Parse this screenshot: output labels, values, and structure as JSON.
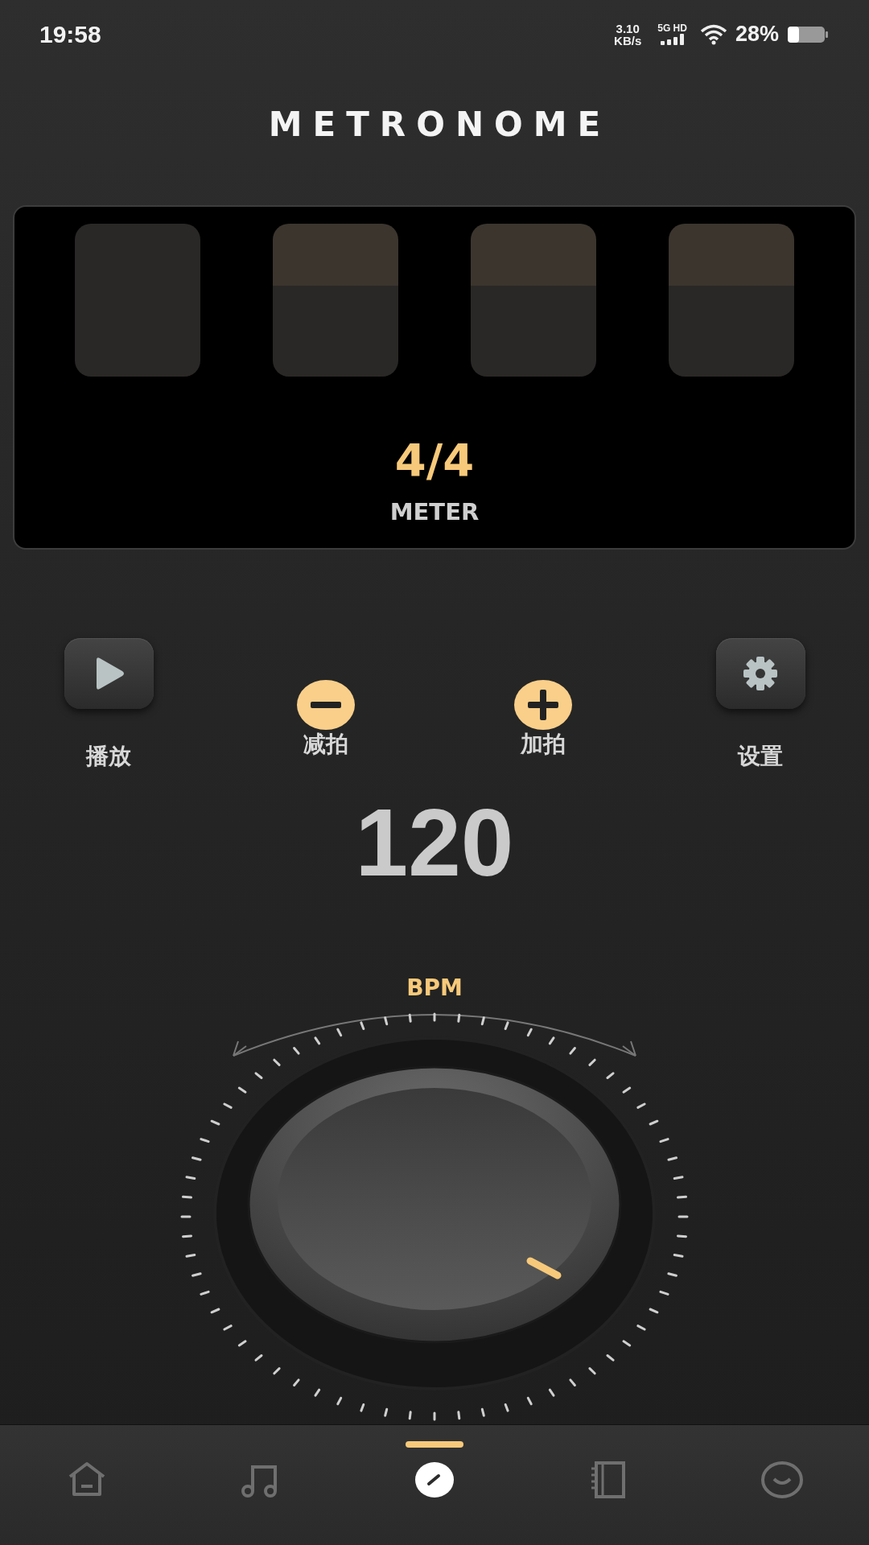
{
  "status_bar": {
    "time": "19:58",
    "net_speed": "3.10",
    "net_unit": "KB/s",
    "network": "5G HD",
    "battery": "28%"
  },
  "title": "METRONOME",
  "meter": {
    "beats": [
      {
        "kind": "plain"
      },
      {
        "kind": "banded"
      },
      {
        "kind": "banded"
      },
      {
        "kind": "banded"
      }
    ],
    "value": "4/4",
    "label": "METER"
  },
  "controls": [
    {
      "kind": "play",
      "label": "播放"
    },
    {
      "kind": "minus",
      "label": "减拍"
    },
    {
      "kind": "plus",
      "label": "加拍"
    },
    {
      "kind": "settings",
      "label": "设置"
    }
  ],
  "tempo": {
    "value": "120",
    "unit": "BPM"
  },
  "tabs": [
    {
      "kind": "home",
      "selected": false
    },
    {
      "kind": "music",
      "selected": false
    },
    {
      "kind": "metronome",
      "selected": true
    },
    {
      "kind": "notebook",
      "selected": false
    },
    {
      "kind": "smile",
      "selected": false
    }
  ]
}
